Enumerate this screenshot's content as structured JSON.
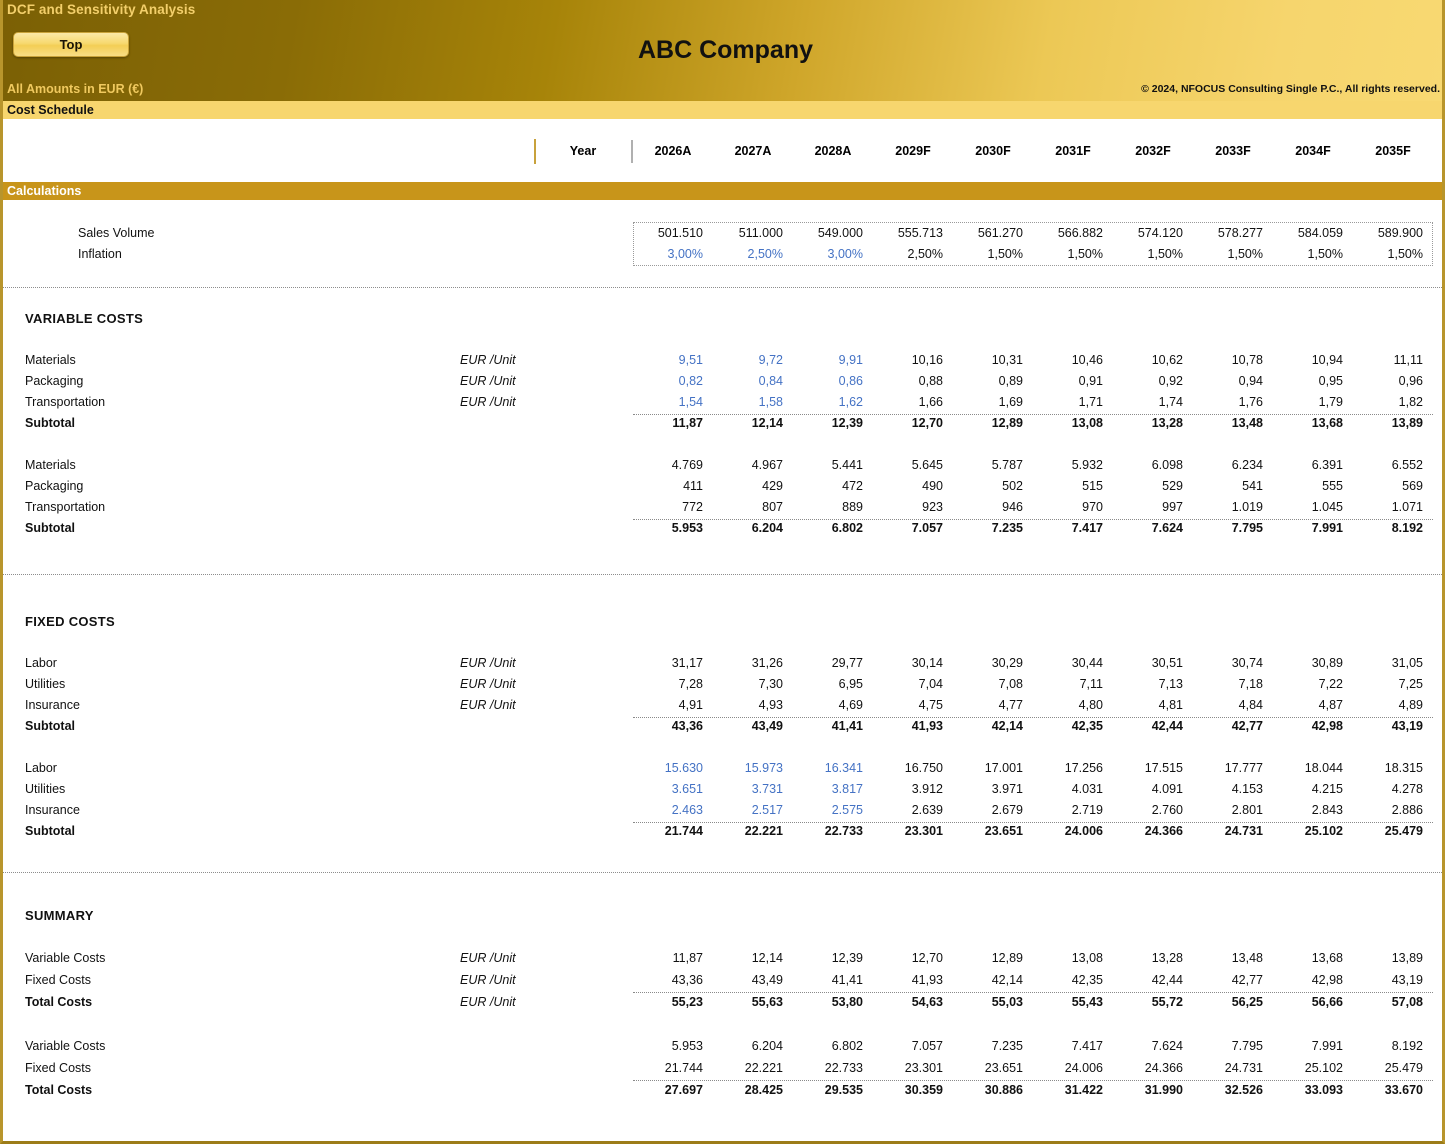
{
  "banner": {
    "title": "DCF and Sensitivity Analysis",
    "top_button": "Top",
    "amounts_note": "All Amounts in  EUR (€)",
    "company": "ABC Company",
    "copyright": "© 2024, NFOCUS Consulting Single P.C., All rights reserved."
  },
  "bars": {
    "cost_schedule": "Cost Schedule",
    "calculations": "Calculations"
  },
  "table": {
    "year_label": "Year",
    "years": [
      "2026A",
      "2027A",
      "2028A",
      "2029F",
      "2030F",
      "2031F",
      "2032F",
      "2033F",
      "2034F",
      "2035F"
    ]
  },
  "units": {
    "eur_per_unit": "EUR /Unit"
  },
  "sections": {
    "variable_costs": "VARIABLE COSTS",
    "fixed_costs": "FIXED COSTS",
    "summary": "SUMMARY"
  },
  "labels": {
    "sales_volume": "Sales Volume",
    "inflation": "Inflation",
    "materials": "Materials",
    "packaging": "Packaging",
    "transportation": "Transportation",
    "labor": "Labor",
    "utilities": "Utilities",
    "insurance": "Insurance",
    "subtotal": "Subtotal",
    "variable_costs": "Variable Costs",
    "fixed_costs": "Fixed Costs",
    "total_costs": "Total Costs"
  },
  "colors": {
    "input_blue": "#4472C4",
    "banner_dark": "#7b6005",
    "banner_light": "#f8d972",
    "bar_light": "#f7d66e",
    "bar_dark": "#c8951a",
    "sheet_border": "#b8952c"
  },
  "chart_data": {
    "type": "table",
    "title": "Cost Schedule",
    "categories": [
      "2026A",
      "2027A",
      "2028A",
      "2029F",
      "2030F",
      "2031F",
      "2032F",
      "2033F",
      "2034F",
      "2035F"
    ],
    "series": [
      {
        "name": "Sales Volume",
        "values": [
          "501.510",
          "511.000",
          "549.000",
          "555.713",
          "561.270",
          "566.882",
          "574.120",
          "578.277",
          "584.059",
          "589.900"
        ]
      },
      {
        "name": "Inflation",
        "values": [
          "3,00%",
          "2,50%",
          "3,00%",
          "2,50%",
          "1,50%",
          "1,50%",
          "1,50%",
          "1,50%",
          "1,50%",
          "1,50%"
        ]
      },
      {
        "name": "Materials (EUR /Unit)",
        "values": [
          "9,51",
          "9,72",
          "9,91",
          "10,16",
          "10,31",
          "10,46",
          "10,62",
          "10,78",
          "10,94",
          "11,11"
        ]
      },
      {
        "name": "Packaging (EUR /Unit)",
        "values": [
          "0,82",
          "0,84",
          "0,86",
          "0,88",
          "0,89",
          "0,91",
          "0,92",
          "0,94",
          "0,95",
          "0,96"
        ]
      },
      {
        "name": "Transportation (EUR /Unit)",
        "values": [
          "1,54",
          "1,58",
          "1,62",
          "1,66",
          "1,69",
          "1,71",
          "1,74",
          "1,76",
          "1,79",
          "1,82"
        ]
      },
      {
        "name": "Variable Subtotal (EUR /Unit)",
        "values": [
          "11,87",
          "12,14",
          "12,39",
          "12,70",
          "12,89",
          "13,08",
          "13,28",
          "13,48",
          "13,68",
          "13,89"
        ]
      },
      {
        "name": "Materials",
        "values": [
          "4.769",
          "4.967",
          "5.441",
          "5.645",
          "5.787",
          "5.932",
          "6.098",
          "6.234",
          "6.391",
          "6.552"
        ]
      },
      {
        "name": "Packaging",
        "values": [
          "411",
          "429",
          "472",
          "490",
          "502",
          "515",
          "529",
          "541",
          "555",
          "569"
        ]
      },
      {
        "name": "Transportation",
        "values": [
          "772",
          "807",
          "889",
          "923",
          "946",
          "970",
          "997",
          "1.019",
          "1.045",
          "1.071"
        ]
      },
      {
        "name": "Variable Subtotal",
        "values": [
          "5.953",
          "6.204",
          "6.802",
          "7.057",
          "7.235",
          "7.417",
          "7.624",
          "7.795",
          "7.991",
          "8.192"
        ]
      },
      {
        "name": "Labor (EUR /Unit)",
        "values": [
          "31,17",
          "31,26",
          "29,77",
          "30,14",
          "30,29",
          "30,44",
          "30,51",
          "30,74",
          "30,89",
          "31,05"
        ]
      },
      {
        "name": "Utilities (EUR /Unit)",
        "values": [
          "7,28",
          "7,30",
          "6,95",
          "7,04",
          "7,08",
          "7,11",
          "7,13",
          "7,18",
          "7,22",
          "7,25"
        ]
      },
      {
        "name": "Insurance (EUR /Unit)",
        "values": [
          "4,91",
          "4,93",
          "4,69",
          "4,75",
          "4,77",
          "4,80",
          "4,81",
          "4,84",
          "4,87",
          "4,89"
        ]
      },
      {
        "name": "Fixed Subtotal (EUR /Unit)",
        "values": [
          "43,36",
          "43,49",
          "41,41",
          "41,93",
          "42,14",
          "42,35",
          "42,44",
          "42,77",
          "42,98",
          "43,19"
        ]
      },
      {
        "name": "Labor",
        "values": [
          "15.630",
          "15.973",
          "16.341",
          "16.750",
          "17.001",
          "17.256",
          "17.515",
          "17.777",
          "18.044",
          "18.315"
        ]
      },
      {
        "name": "Utilities",
        "values": [
          "3.651",
          "3.731",
          "3.817",
          "3.912",
          "3.971",
          "4.031",
          "4.091",
          "4.153",
          "4.215",
          "4.278"
        ]
      },
      {
        "name": "Insurance",
        "values": [
          "2.463",
          "2.517",
          "2.575",
          "2.639",
          "2.679",
          "2.719",
          "2.760",
          "2.801",
          "2.843",
          "2.886"
        ]
      },
      {
        "name": "Fixed Subtotal",
        "values": [
          "21.744",
          "22.221",
          "22.733",
          "23.301",
          "23.651",
          "24.006",
          "24.366",
          "24.731",
          "25.102",
          "25.479"
        ]
      },
      {
        "name": "Summary Variable Costs (EUR /Unit)",
        "values": [
          "11,87",
          "12,14",
          "12,39",
          "12,70",
          "12,89",
          "13,08",
          "13,28",
          "13,48",
          "13,68",
          "13,89"
        ]
      },
      {
        "name": "Summary Fixed Costs (EUR /Unit)",
        "values": [
          "43,36",
          "43,49",
          "41,41",
          "41,93",
          "42,14",
          "42,35",
          "42,44",
          "42,77",
          "42,98",
          "43,19"
        ]
      },
      {
        "name": "Summary Total Costs (EUR /Unit)",
        "values": [
          "55,23",
          "55,63",
          "53,80",
          "54,63",
          "55,03",
          "55,43",
          "55,72",
          "56,25",
          "56,66",
          "57,08"
        ]
      },
      {
        "name": "Summary Variable Costs",
        "values": [
          "5.953",
          "6.204",
          "6.802",
          "7.057",
          "7.235",
          "7.417",
          "7.624",
          "7.795",
          "7.991",
          "8.192"
        ]
      },
      {
        "name": "Summary Fixed Costs",
        "values": [
          "21.744",
          "22.221",
          "22.733",
          "23.301",
          "23.651",
          "24.006",
          "24.366",
          "24.731",
          "25.102",
          "25.479"
        ]
      },
      {
        "name": "Summary Total Costs",
        "values": [
          "27.697",
          "28.425",
          "29.535",
          "30.359",
          "30.886",
          "31.422",
          "31.990",
          "32.526",
          "33.093",
          "33.670"
        ]
      }
    ]
  },
  "rows": {
    "sales_volume": {
      "values": [
        "501.510",
        "511.000",
        "549.000",
        "555.713",
        "561.270",
        "566.882",
        "574.120",
        "578.277",
        "584.059",
        "589.900"
      ],
      "blue": []
    },
    "inflation": {
      "values": [
        "3,00%",
        "2,50%",
        "3,00%",
        "2,50%",
        "1,50%",
        "1,50%",
        "1,50%",
        "1,50%",
        "1,50%",
        "1,50%"
      ],
      "blue": [
        0,
        1,
        2
      ]
    },
    "vc_materials_u": {
      "values": [
        "9,51",
        "9,72",
        "9,91",
        "10,16",
        "10,31",
        "10,46",
        "10,62",
        "10,78",
        "10,94",
        "11,11"
      ],
      "blue": [
        0,
        1,
        2
      ]
    },
    "vc_packaging_u": {
      "values": [
        "0,82",
        "0,84",
        "0,86",
        "0,88",
        "0,89",
        "0,91",
        "0,92",
        "0,94",
        "0,95",
        "0,96"
      ],
      "blue": [
        0,
        1,
        2
      ]
    },
    "vc_transport_u": {
      "values": [
        "1,54",
        "1,58",
        "1,62",
        "1,66",
        "1,69",
        "1,71",
        "1,74",
        "1,76",
        "1,79",
        "1,82"
      ],
      "blue": [
        0,
        1,
        2
      ]
    },
    "vc_subtotal_u": {
      "values": [
        "11,87",
        "12,14",
        "12,39",
        "12,70",
        "12,89",
        "13,08",
        "13,28",
        "13,48",
        "13,68",
        "13,89"
      ],
      "blue": []
    },
    "vc_materials": {
      "values": [
        "4.769",
        "4.967",
        "5.441",
        "5.645",
        "5.787",
        "5.932",
        "6.098",
        "6.234",
        "6.391",
        "6.552"
      ],
      "blue": []
    },
    "vc_packaging": {
      "values": [
        "411",
        "429",
        "472",
        "490",
        "502",
        "515",
        "529",
        "541",
        "555",
        "569"
      ],
      "blue": []
    },
    "vc_transport": {
      "values": [
        "772",
        "807",
        "889",
        "923",
        "946",
        "970",
        "997",
        "1.019",
        "1.045",
        "1.071"
      ],
      "blue": []
    },
    "vc_subtotal": {
      "values": [
        "5.953",
        "6.204",
        "6.802",
        "7.057",
        "7.235",
        "7.417",
        "7.624",
        "7.795",
        "7.991",
        "8.192"
      ],
      "blue": []
    },
    "fc_labor_u": {
      "values": [
        "31,17",
        "31,26",
        "29,77",
        "30,14",
        "30,29",
        "30,44",
        "30,51",
        "30,74",
        "30,89",
        "31,05"
      ],
      "blue": []
    },
    "fc_utilities_u": {
      "values": [
        "7,28",
        "7,30",
        "6,95",
        "7,04",
        "7,08",
        "7,11",
        "7,13",
        "7,18",
        "7,22",
        "7,25"
      ],
      "blue": []
    },
    "fc_insurance_u": {
      "values": [
        "4,91",
        "4,93",
        "4,69",
        "4,75",
        "4,77",
        "4,80",
        "4,81",
        "4,84",
        "4,87",
        "4,89"
      ],
      "blue": []
    },
    "fc_subtotal_u": {
      "values": [
        "43,36",
        "43,49",
        "41,41",
        "41,93",
        "42,14",
        "42,35",
        "42,44",
        "42,77",
        "42,98",
        "43,19"
      ],
      "blue": []
    },
    "fc_labor": {
      "values": [
        "15.630",
        "15.973",
        "16.341",
        "16.750",
        "17.001",
        "17.256",
        "17.515",
        "17.777",
        "18.044",
        "18.315"
      ],
      "blue": [
        0,
        1,
        2
      ]
    },
    "fc_utilities": {
      "values": [
        "3.651",
        "3.731",
        "3.817",
        "3.912",
        "3.971",
        "4.031",
        "4.091",
        "4.153",
        "4.215",
        "4.278"
      ],
      "blue": [
        0,
        1,
        2
      ]
    },
    "fc_insurance": {
      "values": [
        "2.463",
        "2.517",
        "2.575",
        "2.639",
        "2.679",
        "2.719",
        "2.760",
        "2.801",
        "2.843",
        "2.886"
      ],
      "blue": [
        0,
        1,
        2
      ]
    },
    "fc_subtotal": {
      "values": [
        "21.744",
        "22.221",
        "22.733",
        "23.301",
        "23.651",
        "24.006",
        "24.366",
        "24.731",
        "25.102",
        "25.479"
      ],
      "blue": []
    },
    "sum_var_u": {
      "values": [
        "11,87",
        "12,14",
        "12,39",
        "12,70",
        "12,89",
        "13,08",
        "13,28",
        "13,48",
        "13,68",
        "13,89"
      ],
      "blue": []
    },
    "sum_fix_u": {
      "values": [
        "43,36",
        "43,49",
        "41,41",
        "41,93",
        "42,14",
        "42,35",
        "42,44",
        "42,77",
        "42,98",
        "43,19"
      ],
      "blue": []
    },
    "sum_total_u": {
      "values": [
        "55,23",
        "55,63",
        "53,80",
        "54,63",
        "55,03",
        "55,43",
        "55,72",
        "56,25",
        "56,66",
        "57,08"
      ],
      "blue": []
    },
    "sum_var": {
      "values": [
        "5.953",
        "6.204",
        "6.802",
        "7.057",
        "7.235",
        "7.417",
        "7.624",
        "7.795",
        "7.991",
        "8.192"
      ],
      "blue": []
    },
    "sum_fix": {
      "values": [
        "21.744",
        "22.221",
        "22.733",
        "23.301",
        "23.651",
        "24.006",
        "24.366",
        "24.731",
        "25.102",
        "25.479"
      ],
      "blue": []
    },
    "sum_total": {
      "values": [
        "27.697",
        "28.425",
        "29.535",
        "30.359",
        "30.886",
        "31.422",
        "31.990",
        "32.526",
        "33.093",
        "33.670"
      ],
      "blue": []
    }
  }
}
